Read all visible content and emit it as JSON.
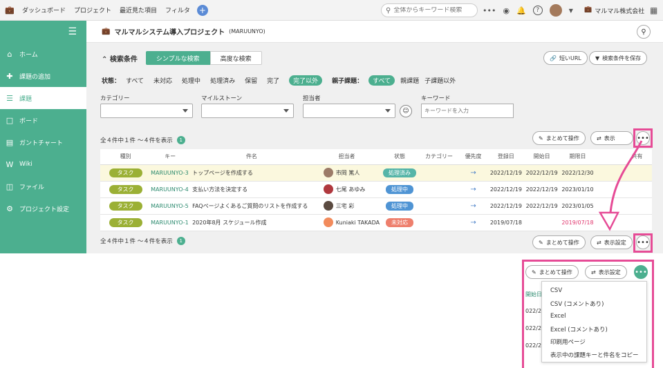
{
  "topbar": {
    "nav": [
      "ダッシュボード",
      "プロジェクト",
      "最近見た項目",
      "フィルタ"
    ],
    "search_placeholder": "全体からキーワード検索",
    "org_name": "マルマル株式会社"
  },
  "sidebar": {
    "items": [
      {
        "label": "ホーム",
        "icon": "home-icon"
      },
      {
        "label": "課題の追加",
        "icon": "plus-icon"
      },
      {
        "label": "課題",
        "icon": "list-icon",
        "active": true
      },
      {
        "label": "ボード",
        "icon": "board-icon"
      },
      {
        "label": "ガントチャート",
        "icon": "gantt-icon"
      },
      {
        "label": "Wiki",
        "icon": "wiki-icon"
      },
      {
        "label": "ファイル",
        "icon": "folder-icon"
      },
      {
        "label": "プロジェクト設定",
        "icon": "gear-icon"
      }
    ]
  },
  "project": {
    "title": "マルマルシステム導入プロジェクト",
    "key": "(MARUUNYO)"
  },
  "conditions": {
    "title": "検索条件",
    "tab_simple": "シンプルな検索",
    "tab_advanced": "高度な検索",
    "short_url": "短いURL",
    "save_conditions": "検索条件を保存"
  },
  "status_filter": {
    "label": "状態：",
    "options": [
      "すべて",
      "未対応",
      "処理中",
      "処理済み",
      "保留",
      "完了"
    ],
    "selected": "完了以外",
    "parent_label": "親子課題：",
    "parent_selected": "すべて",
    "parent_options": [
      "親課題",
      "子課題以外"
    ]
  },
  "fields": {
    "category": "カテゴリー",
    "milestone": "マイルストーン",
    "assignee": "担当者",
    "keyword": "キーワード",
    "keyword_placeholder": "キーワードを入力"
  },
  "results": {
    "count_text": "全４件中１件 〜４件を表示",
    "page": "1",
    "bulk_action": "まとめて操作",
    "display_settings": "表示設定",
    "display_settings_partial": "表示"
  },
  "table": {
    "headers": [
      "種別",
      "キー",
      "件名",
      "担当者",
      "状態",
      "カテゴリー",
      "優先度",
      "登録日",
      "開始日",
      "期限日",
      "",
      "共有"
    ],
    "rows": [
      {
        "type": "タスク",
        "key": "MARUUNYO-3",
        "subject": "トップページを作成する",
        "assignee": "市岡 篤人",
        "status": "処理済み",
        "status_color": "#56b5a8",
        "priority": "→",
        "created": "2022/12/19",
        "start": "2022/12/19",
        "due": "2022/12/30",
        "overdue": false
      },
      {
        "type": "タスク",
        "key": "MARUUNYO-4",
        "subject": "支払い方法を決定する",
        "assignee": "七尾 あゆみ",
        "status": "処理中",
        "status_color": "#4f94d4",
        "priority": "→",
        "created": "2022/12/19",
        "start": "2022/12/19",
        "due": "2023/01/10",
        "overdue": false
      },
      {
        "type": "タスク",
        "key": "MARUUNYO-5",
        "subject": "FAQページよくあるご質問のリストを作成する",
        "assignee": "三宅 彩",
        "status": "処理中",
        "status_color": "#4f94d4",
        "priority": "→",
        "created": "2022/12/19",
        "start": "2022/12/19",
        "due": "2023/01/05",
        "overdue": false
      },
      {
        "type": "タスク",
        "key": "MARUUNYO-1",
        "subject": "2020年8月 スケジュール作成",
        "assignee": "Kuniaki TAKADA",
        "status": "未対応",
        "status_color": "#ee7f6d",
        "priority": "→",
        "created": "2019/07/18",
        "start": "",
        "due": "2019/07/18",
        "overdue": true
      }
    ]
  },
  "menu": {
    "items": [
      "CSV",
      "CSV (コメントあり)",
      "Excel",
      "Excel (コメントあり)",
      "印刷用ページ",
      "表示中の課題キーと件名をコピー"
    ]
  },
  "peek": {
    "header": "開始日",
    "rows": [
      "022/2",
      "022/2",
      "022/2"
    ]
  },
  "colors": {
    "accent": "#4caf8f",
    "callout": "#e64b96"
  }
}
